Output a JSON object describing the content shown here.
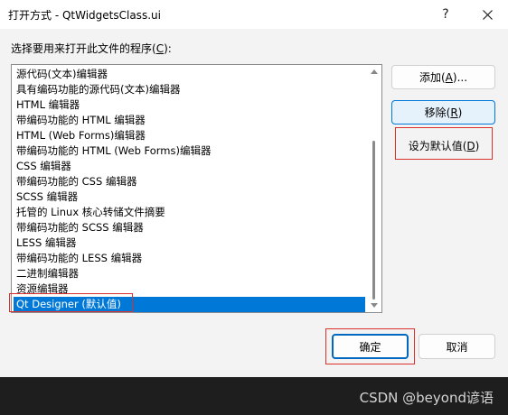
{
  "window": {
    "title": "打开方式 - QtWidgetsClass.ui",
    "help_glyph": "?",
    "close_icon": "close-icon"
  },
  "prompt": {
    "text": "选择要用来打开此文件的程序(",
    "mnemonic": "C",
    "suffix": "):"
  },
  "programs": [
    "源代码(文本)编辑器",
    "具有编码功能的源代码(文本)编辑器",
    "HTML 编辑器",
    "带编码功能的 HTML 编辑器",
    "HTML (Web Forms)编辑器",
    "带编码功能的 HTML (Web Forms)编辑器",
    "CSS 编辑器",
    "带编码功能的 CSS 编辑器",
    "SCSS 编辑器",
    "托管的 Linux 核心转储文件摘要",
    "带编码功能的 SCSS 编辑器",
    "LESS 编辑器",
    "带编码功能的 LESS 编辑器",
    "二进制编辑器",
    "资源编辑器",
    "Qt Designer (默认值)"
  ],
  "selected_program": "Qt Designer (默认值)",
  "buttons": {
    "add": {
      "text": "添加(",
      "mnemonic": "A",
      "suffix": ")..."
    },
    "remove": {
      "text": "移除(",
      "mnemonic": "R",
      "suffix": ")"
    },
    "set_default": {
      "text": "设为默认值(",
      "mnemonic": "D",
      "suffix": ")"
    },
    "ok": "确定",
    "cancel": "取消"
  },
  "colors": {
    "selection": "#0078d7",
    "annotation": "#d9312b",
    "primary_border": "#0078d7"
  },
  "watermark": "CSDN @beyond谚语"
}
